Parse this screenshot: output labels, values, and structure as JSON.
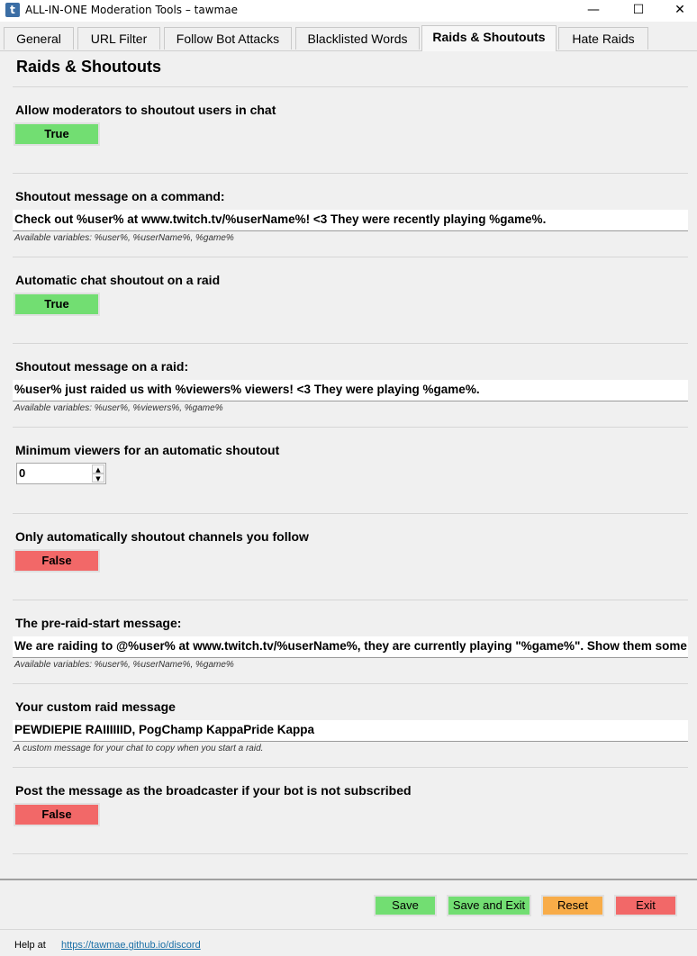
{
  "window": {
    "title": "ALL-IN-ONE Moderation Tools – tawmae",
    "icon_letter": "t",
    "minimize": "—",
    "maximize": "☐",
    "close": "✕"
  },
  "tabs": [
    {
      "label": "General",
      "active": false
    },
    {
      "label": "URL Filter",
      "active": false
    },
    {
      "label": "Follow Bot Attacks",
      "active": false
    },
    {
      "label": "Blacklisted Words",
      "active": false
    },
    {
      "label": "Raids & Shoutouts",
      "active": true
    },
    {
      "label": "Hate Raids",
      "active": false
    }
  ],
  "page_title": "Raids & Shoutouts",
  "settings": {
    "allow_mod_shoutout": {
      "label": "Allow moderators to shoutout users in chat",
      "value": "True"
    },
    "shoutout_command_msg": {
      "label": "Shoutout message on a command:",
      "value": "Check out %user% at www.twitch.tv/%userName%! <3 They were recently playing %game%.",
      "hint": "Available variables: %user%, %userName%, %game%"
    },
    "auto_shoutout_raid": {
      "label": "Automatic chat shoutout on a raid",
      "value": "True"
    },
    "shoutout_raid_msg": {
      "label": "Shoutout message on a raid:",
      "value": "%user% just raided us with %viewers% viewers! <3 They were playing %game%.",
      "hint": "Available variables: %user%, %viewers%, %game%"
    },
    "min_viewers": {
      "label": "Minimum viewers for an automatic shoutout",
      "value": "0",
      "up": "▲",
      "down": "▼"
    },
    "only_followed": {
      "label": "Only automatically shoutout channels you follow",
      "value": "False"
    },
    "pre_raid_msg": {
      "label": "The pre-raid-start message:",
      "value": "We are raiding to @%user% at www.twitch.tv/%userName%, they are currently playing \"%game%\". Show them some lov",
      "hint": "Available variables: %user%, %userName%, %game%"
    },
    "custom_raid_msg": {
      "label": "Your custom raid message",
      "value": "PEWDIEPIE RAIIIIIID, PogChamp KappaPride Kappa",
      "hint": "A custom message for your chat to copy when you start a raid."
    },
    "post_as_broadcaster": {
      "label": "Post the message as the broadcaster if your bot is not subscribed",
      "value": "False"
    }
  },
  "footer": {
    "save": "Save",
    "save_exit": "Save and Exit",
    "reset": "Reset",
    "exit": "Exit",
    "help_label": "Help at",
    "help_link": "https://tawmae.github.io/discord"
  },
  "colors": {
    "true_green": "#72de72",
    "false_red": "#f26868",
    "reset_orange": "#f8ac48",
    "link_blue": "#1a6fa6"
  }
}
